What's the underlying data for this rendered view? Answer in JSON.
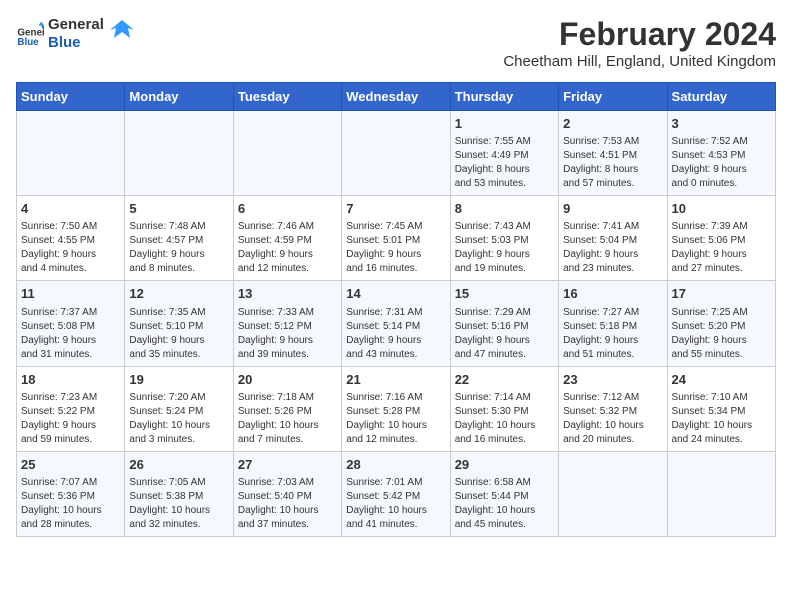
{
  "header": {
    "logo_line1": "General",
    "logo_line2": "Blue",
    "title": "February 2024",
    "subtitle": "Cheetham Hill, England, United Kingdom"
  },
  "days_of_week": [
    "Sunday",
    "Monday",
    "Tuesday",
    "Wednesday",
    "Thursday",
    "Friday",
    "Saturday"
  ],
  "weeks": [
    [
      {
        "day": "",
        "info": ""
      },
      {
        "day": "",
        "info": ""
      },
      {
        "day": "",
        "info": ""
      },
      {
        "day": "",
        "info": ""
      },
      {
        "day": "1",
        "info": "Sunrise: 7:55 AM\nSunset: 4:49 PM\nDaylight: 8 hours\nand 53 minutes."
      },
      {
        "day": "2",
        "info": "Sunrise: 7:53 AM\nSunset: 4:51 PM\nDaylight: 8 hours\nand 57 minutes."
      },
      {
        "day": "3",
        "info": "Sunrise: 7:52 AM\nSunset: 4:53 PM\nDaylight: 9 hours\nand 0 minutes."
      }
    ],
    [
      {
        "day": "4",
        "info": "Sunrise: 7:50 AM\nSunset: 4:55 PM\nDaylight: 9 hours\nand 4 minutes."
      },
      {
        "day": "5",
        "info": "Sunrise: 7:48 AM\nSunset: 4:57 PM\nDaylight: 9 hours\nand 8 minutes."
      },
      {
        "day": "6",
        "info": "Sunrise: 7:46 AM\nSunset: 4:59 PM\nDaylight: 9 hours\nand 12 minutes."
      },
      {
        "day": "7",
        "info": "Sunrise: 7:45 AM\nSunset: 5:01 PM\nDaylight: 9 hours\nand 16 minutes."
      },
      {
        "day": "8",
        "info": "Sunrise: 7:43 AM\nSunset: 5:03 PM\nDaylight: 9 hours\nand 19 minutes."
      },
      {
        "day": "9",
        "info": "Sunrise: 7:41 AM\nSunset: 5:04 PM\nDaylight: 9 hours\nand 23 minutes."
      },
      {
        "day": "10",
        "info": "Sunrise: 7:39 AM\nSunset: 5:06 PM\nDaylight: 9 hours\nand 27 minutes."
      }
    ],
    [
      {
        "day": "11",
        "info": "Sunrise: 7:37 AM\nSunset: 5:08 PM\nDaylight: 9 hours\nand 31 minutes."
      },
      {
        "day": "12",
        "info": "Sunrise: 7:35 AM\nSunset: 5:10 PM\nDaylight: 9 hours\nand 35 minutes."
      },
      {
        "day": "13",
        "info": "Sunrise: 7:33 AM\nSunset: 5:12 PM\nDaylight: 9 hours\nand 39 minutes."
      },
      {
        "day": "14",
        "info": "Sunrise: 7:31 AM\nSunset: 5:14 PM\nDaylight: 9 hours\nand 43 minutes."
      },
      {
        "day": "15",
        "info": "Sunrise: 7:29 AM\nSunset: 5:16 PM\nDaylight: 9 hours\nand 47 minutes."
      },
      {
        "day": "16",
        "info": "Sunrise: 7:27 AM\nSunset: 5:18 PM\nDaylight: 9 hours\nand 51 minutes."
      },
      {
        "day": "17",
        "info": "Sunrise: 7:25 AM\nSunset: 5:20 PM\nDaylight: 9 hours\nand 55 minutes."
      }
    ],
    [
      {
        "day": "18",
        "info": "Sunrise: 7:23 AM\nSunset: 5:22 PM\nDaylight: 9 hours\nand 59 minutes."
      },
      {
        "day": "19",
        "info": "Sunrise: 7:20 AM\nSunset: 5:24 PM\nDaylight: 10 hours\nand 3 minutes."
      },
      {
        "day": "20",
        "info": "Sunrise: 7:18 AM\nSunset: 5:26 PM\nDaylight: 10 hours\nand 7 minutes."
      },
      {
        "day": "21",
        "info": "Sunrise: 7:16 AM\nSunset: 5:28 PM\nDaylight: 10 hours\nand 12 minutes."
      },
      {
        "day": "22",
        "info": "Sunrise: 7:14 AM\nSunset: 5:30 PM\nDaylight: 10 hours\nand 16 minutes."
      },
      {
        "day": "23",
        "info": "Sunrise: 7:12 AM\nSunset: 5:32 PM\nDaylight: 10 hours\nand 20 minutes."
      },
      {
        "day": "24",
        "info": "Sunrise: 7:10 AM\nSunset: 5:34 PM\nDaylight: 10 hours\nand 24 minutes."
      }
    ],
    [
      {
        "day": "25",
        "info": "Sunrise: 7:07 AM\nSunset: 5:36 PM\nDaylight: 10 hours\nand 28 minutes."
      },
      {
        "day": "26",
        "info": "Sunrise: 7:05 AM\nSunset: 5:38 PM\nDaylight: 10 hours\nand 32 minutes."
      },
      {
        "day": "27",
        "info": "Sunrise: 7:03 AM\nSunset: 5:40 PM\nDaylight: 10 hours\nand 37 minutes."
      },
      {
        "day": "28",
        "info": "Sunrise: 7:01 AM\nSunset: 5:42 PM\nDaylight: 10 hours\nand 41 minutes."
      },
      {
        "day": "29",
        "info": "Sunrise: 6:58 AM\nSunset: 5:44 PM\nDaylight: 10 hours\nand 45 minutes."
      },
      {
        "day": "",
        "info": ""
      },
      {
        "day": "",
        "info": ""
      }
    ]
  ]
}
